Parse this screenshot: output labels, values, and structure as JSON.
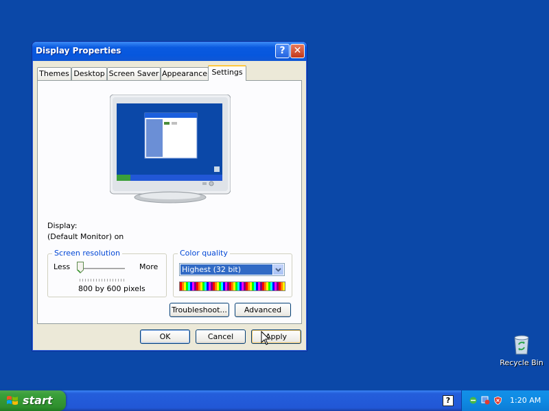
{
  "window": {
    "title": "Display Properties",
    "help_button": "?",
    "close_button": "✕"
  },
  "tabs": [
    {
      "label": "Themes",
      "active": false
    },
    {
      "label": "Desktop",
      "active": false
    },
    {
      "label": "Screen Saver",
      "active": false
    },
    {
      "label": "Appearance",
      "active": false
    },
    {
      "label": "Settings",
      "active": true
    }
  ],
  "display": {
    "label": "Display:",
    "value": "(Default Monitor) on"
  },
  "resolution": {
    "title": "Screen resolution",
    "less": "Less",
    "more": "More",
    "value": "800 by 600 pixels",
    "slider_fraction": 0
  },
  "color_quality": {
    "title": "Color quality",
    "selected": "Highest (32 bit)"
  },
  "buttons": {
    "troubleshoot": "Troubleshoot...",
    "advanced": "Advanced",
    "ok": "OK",
    "cancel": "Cancel",
    "apply": "Apply"
  },
  "desktop": {
    "recycle_bin": "Recycle Bin"
  },
  "taskbar": {
    "start": "start",
    "help_icon": "?",
    "time": "1:20 AM"
  },
  "colors": {
    "desktop": "#0b48a8",
    "titlebar": "#0a5ae0",
    "taskbar": "#245edb",
    "start": "#3a9f3a",
    "tray": "#0f8ae3"
  }
}
